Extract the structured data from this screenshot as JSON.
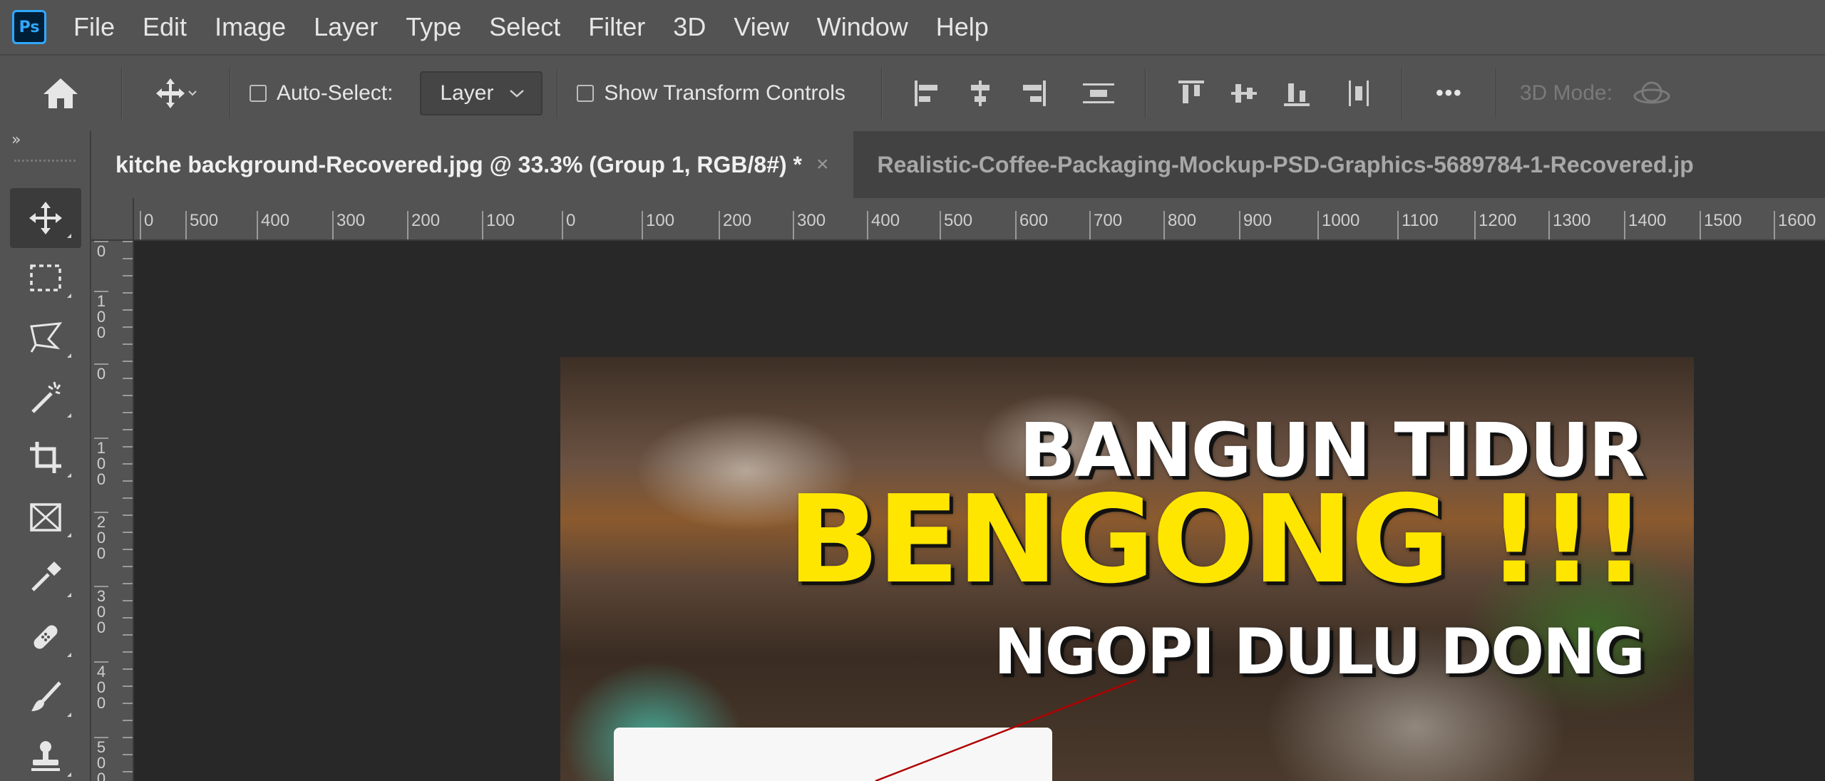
{
  "app": {
    "logo": "Ps"
  },
  "menu": [
    "File",
    "Edit",
    "Image",
    "Layer",
    "Type",
    "Select",
    "Filter",
    "3D",
    "View",
    "Window",
    "Help"
  ],
  "options": {
    "auto_select_label": "Auto-Select:",
    "auto_select_checked": false,
    "layer_select_value": "Layer",
    "show_transform_label": "Show Transform Controls",
    "show_transform_checked": false,
    "more_label": "•••",
    "mode_3d_label": "3D Mode:"
  },
  "toolbar": {
    "collapse_label": "»",
    "tools": [
      "move-tool",
      "marquee-tool",
      "lasso-tool",
      "magic-wand-tool",
      "crop-tool",
      "frame-tool",
      "eyedropper-tool",
      "healing-brush-tool",
      "brush-tool",
      "clone-stamp-tool"
    ],
    "active_tool": "move-tool"
  },
  "tabs": [
    {
      "label": "kitche background-Recovered.jpg @ 33.3% (Group 1, RGB/8#) *",
      "active": true,
      "close": "×"
    },
    {
      "label": "Realistic-Coffee-Packaging-Mockup-PSD-Graphics-5689784-1-Recovered.jp",
      "active": false
    }
  ],
  "ruler_top": [
    "0",
    "500",
    "400",
    "300",
    "200",
    "100",
    "0",
    "100",
    "200",
    "300",
    "400",
    "500",
    "600",
    "700",
    "800",
    "900",
    "1000",
    "1100",
    "1200",
    "1300",
    "1400",
    "1500",
    "1600"
  ],
  "ruler_left": [
    "0",
    "100",
    "0",
    "100",
    "200",
    "300",
    "400",
    "500"
  ],
  "document": {
    "line1": "BANGUN TIDUR",
    "line2": "BENGONG !!!",
    "line3": "NGOPI DULU DONG"
  },
  "colors": {
    "headline_white": "#ffffff",
    "headline_yellow": "#ffe600",
    "annotation_line": "#b00000",
    "ps_blue": "#31a8ff"
  }
}
